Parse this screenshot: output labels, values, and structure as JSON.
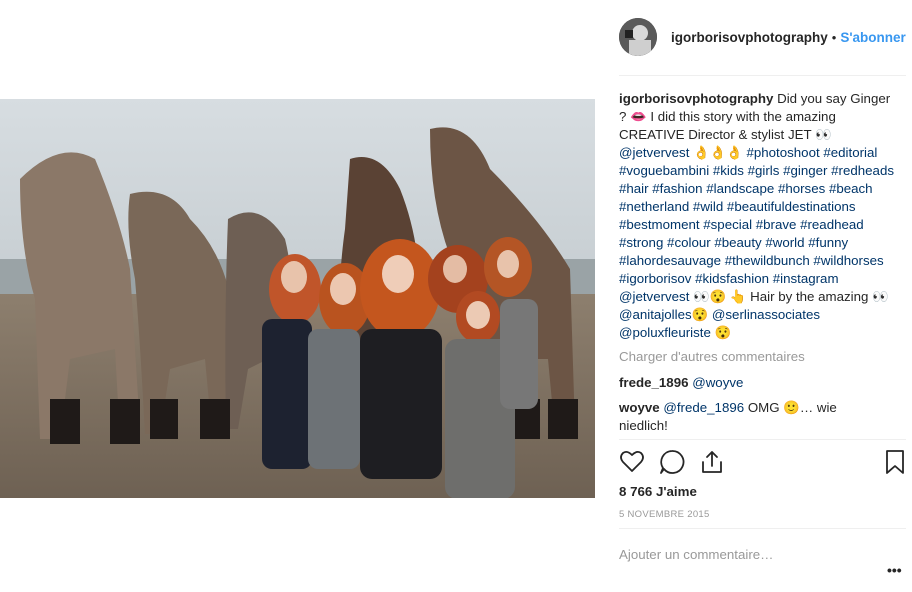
{
  "post": {
    "author": "igorborisovphotography",
    "separator": "•",
    "follow_label": "S'abonner",
    "caption": {
      "author": "igorborisovphotography",
      "text_1": " Did you say Ginger ? 👄 I did this story with the amazing CREATIVE Director & stylist JET 👀 ",
      "mention_1": "@jetvervest",
      "text_2": " 👌👌👌 ",
      "hashtags_1": "#photoshoot #editorial #voguebambini #kids #girls #ginger #redheads #hair #fashion #landscape #horses #beach #netherland #wild #beautifuldestinations #bestmoment #special #brave #readhead #strong #colour #beauty #world #funny #lahordesauvage #thewildbunch #wildhorses #igorborisov #kidsfashion #instagram",
      "text_3": " ",
      "mention_2": "@jetvervest",
      "text_4": " 👀😯 👆 Hair by the amazing 👀 ",
      "mention_3": "@anitajolles",
      "text_5": "😯 ",
      "mention_4": "@serlinassociates",
      "text_6": " ",
      "mention_5": "@poluxfleuriste",
      "text_7": " 😯"
    },
    "load_more": "Charger d'autres commentaires",
    "comments": [
      {
        "user": "frede_1896",
        "mention": "@woyve",
        "text": ""
      },
      {
        "user": "woyve",
        "mention": "@frede_1896",
        "text": " OMG 🙂… wie niedlich!"
      }
    ],
    "likes": "8 766 J'aime",
    "date": "5 NOVEMBRE 2015",
    "add_comment_placeholder": "Ajouter un commentaire…",
    "more_options": "•••"
  },
  "icons": [
    "heart-icon",
    "comment-icon",
    "share-icon",
    "bookmark-icon"
  ],
  "colors": {
    "link": "#3897f0",
    "tag": "#003569",
    "muted": "#999999",
    "text": "#262626"
  }
}
